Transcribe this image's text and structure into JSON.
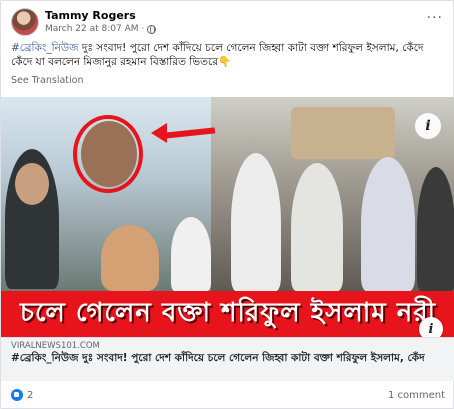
{
  "post": {
    "author": "Tammy Rogers",
    "timestamp": "March 22 at 8:07 AM",
    "privacy_icon": "globe-icon",
    "more_icon": "ellipsis-icon",
    "more_label": "···",
    "caption_hashtag": "#ব্রেকিং_নিউজ",
    "caption_text": " দুঃ সংবাদ! পুরো দেশ কাঁদিয়ে চলে গেলেন জিহ্বা কাটা বক্তা শরিফুল ইসলাম, কেঁদে কেঁদে যা বললেন মিজানুর রহমান বিস্তারিত ভিতরে",
    "caption_emoji": "👇",
    "see_translation": "See Translation"
  },
  "image": {
    "banner_text": "চলে গেলেন বক্তা শরিফুল ইসলাম নরী",
    "info_label": "i"
  },
  "link_preview": {
    "domain": "VIRALNEWS101.COM",
    "title": "#ব্রেকিং_নিউজ দুঃ সংবাদ! পুরো দেশ কাঁদিয়ে চলে গেলেন জিহ্বা কাটা বক্তা শরিফুল ইসলাম, কেঁদ",
    "info_label": "i"
  },
  "footer": {
    "reaction_count": "2",
    "comment_count": "1 comment"
  },
  "colors": {
    "hashtag": "#385898",
    "banner": "#e8141b",
    "like": "#1877f2"
  }
}
